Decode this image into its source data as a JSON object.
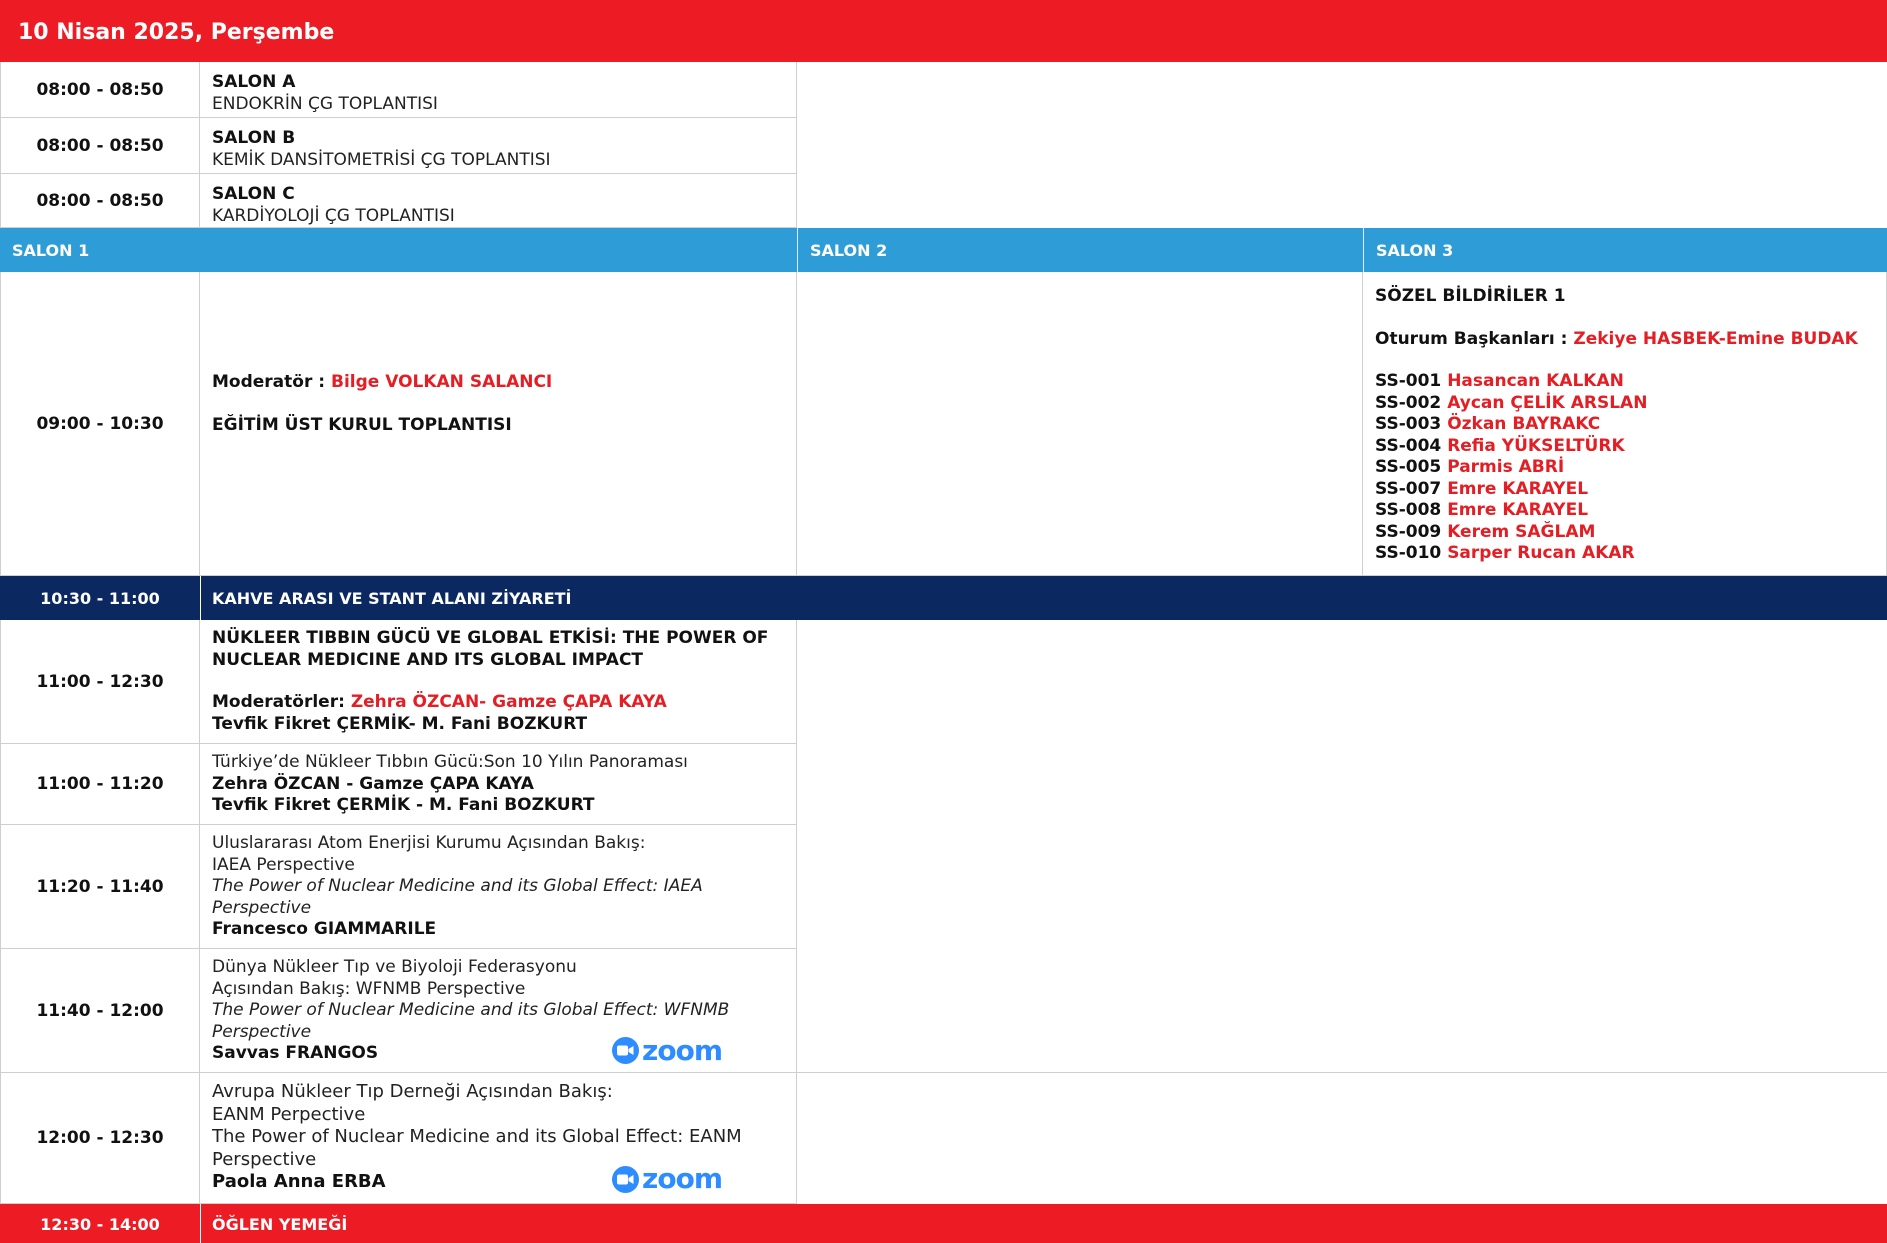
{
  "header": {
    "date": "10 Nisan 2025, Perşembe"
  },
  "early_sessions": [
    {
      "time": "08:00 - 08:50",
      "salon": "SALON A",
      "title": "ENDOKRİN ÇG TOPLANTISI"
    },
    {
      "time": "08:00 - 08:50",
      "salon": "SALON B",
      "title": "KEMİK DANSİTOMETRİSİ ÇG TOPLANTISI"
    },
    {
      "time": "08:00 - 08:50",
      "salon": "SALON C",
      "title": "KARDİYOLOJİ ÇG TOPLANTISI"
    }
  ],
  "salon_headers": [
    "SALON 1",
    "SALON 2",
    "SALON 3"
  ],
  "block_0900": {
    "time": "09:00 - 10:30",
    "moderator_label": "Moderatör :",
    "moderator_name": "Bilge VOLKAN SALANCI",
    "title": "EĞİTİM ÜST KURUL TOPLANTISI",
    "salon3": {
      "title": "SÖZEL BİLDİRİLER 1",
      "chairs_label": "Oturum Başkanları :",
      "chairs_names": "Zekiye HASBEK-Emine BUDAK",
      "papers": [
        {
          "code": "SS-001",
          "name": "Hasancan KALKAN"
        },
        {
          "code": "SS-002",
          "name": "Aycan ÇELİK ARSLAN"
        },
        {
          "code": "SS-003",
          "name": "Özkan BAYRAKC"
        },
        {
          "code": "SS-004",
          "name": "Refia YÜKSELTÜRK"
        },
        {
          "code": "SS-005",
          "name": "Parmis ABRİ"
        },
        {
          "code": "SS-007",
          "name": "Emre KARAYEL"
        },
        {
          "code": "SS-008",
          "name": "Emre KARAYEL"
        },
        {
          "code": "SS-009",
          "name": "Kerem SAĞLAM"
        },
        {
          "code": "SS-010",
          "name": " Sarper Rucan AKAR"
        }
      ]
    }
  },
  "coffee": {
    "time": "10:30 - 11:00",
    "title": "KAHVE ARASI VE STANT ALANI ZİYARETİ"
  },
  "session_1100": {
    "time": "11:00 - 12:30",
    "title_line1": "NÜKLEER TIBBIN GÜCÜ VE GLOBAL ETKİSİ: THE POWER OF",
    "title_line2": "NUCLEAR MEDICINE AND ITS GLOBAL IMPACT",
    "moderators_label": "Moderatörler:",
    "moderators_line1": "Zehra ÖZCAN- Gamze ÇAPA KAYA",
    "moderators_line2": "Tevfik Fikret ÇERMİK- M. Fani BOZKURT"
  },
  "talks": [
    {
      "time": "11:00 - 11:20",
      "lines": [
        "Türkiye’de Nükleer Tıbbın Gücü:Son 10 Yılın Panoraması"
      ],
      "italic": [],
      "speakers": [
        "Zehra ÖZCAN - Gamze ÇAPA KAYA",
        "Tevfik Fikret ÇERMİK - M. Fani BOZKURT"
      ]
    },
    {
      "time": "11:20 - 11:40",
      "lines": [
        "Uluslararası Atom Enerjisi Kurumu Açısından Bakış:",
        "IAEA Perspective"
      ],
      "italic": [
        "The Power of Nuclear Medicine and its Global Effect: IAEA",
        "Perspective"
      ],
      "speakers": [
        "Francesco GIAMMARILE"
      ]
    },
    {
      "time": "11:40 - 12:00",
      "lines": [
        "Dünya Nükleer Tıp ve Biyoloji Federasyonu",
        "Açısından Bakış: WFNMB Perspective"
      ],
      "italic": [
        "The Power of Nuclear Medicine and its Global Effect: WFNMB",
        "Perspective"
      ],
      "speakers": [
        "Savvas FRANGOS"
      ],
      "zoom": "zoom"
    },
    {
      "time": "12:00 - 12:30",
      "lines": [
        "Avrupa Nükleer Tıp Derneği Açısından Bakış:",
        "EANM Perpective",
        "The Power of Nuclear Medicine and its Global Effect: EANM",
        "Perspective"
      ],
      "italic": [],
      "speakers": [
        "Paola Anna ERBA"
      ],
      "zoom": "zoom"
    }
  ],
  "lunch": {
    "time": "12:30 - 14:00",
    "title": "ÖĞLEN YEMEĞİ"
  },
  "colors": {
    "red": "#ed1c24",
    "blue": "#2e9cd6",
    "navy": "#0b2860",
    "zoom": "#2d8cff"
  }
}
